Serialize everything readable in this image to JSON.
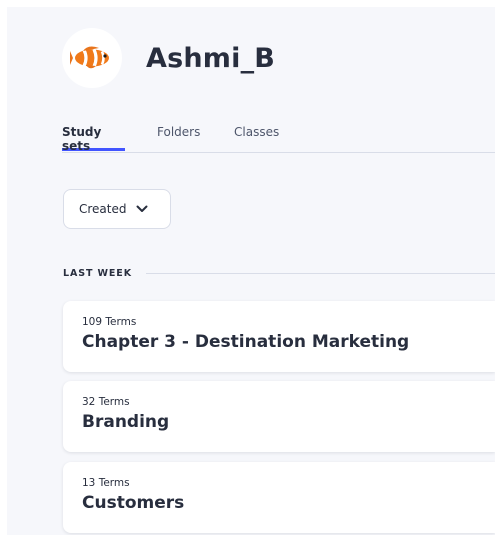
{
  "profile": {
    "username": "Ashmi_B",
    "avatar_icon": "clownfish-avatar-icon"
  },
  "tabs": [
    {
      "label": "Study sets",
      "active": true
    },
    {
      "label": "Folders",
      "active": false
    },
    {
      "label": "Classes",
      "active": false
    }
  ],
  "filter": {
    "selected": "Created",
    "icon": "chevron-down-icon"
  },
  "section": {
    "label": "LAST WEEK"
  },
  "study_sets": [
    {
      "terms": "109 Terms",
      "title": "Chapter 3 - Destination Marketing"
    },
    {
      "terms": "32 Terms",
      "title": "Branding"
    },
    {
      "terms": "13 Terms",
      "title": "Customers"
    }
  ],
  "colors": {
    "accent": "#4255ff",
    "background": "#f6f7fb",
    "text": "#282e3e"
  }
}
